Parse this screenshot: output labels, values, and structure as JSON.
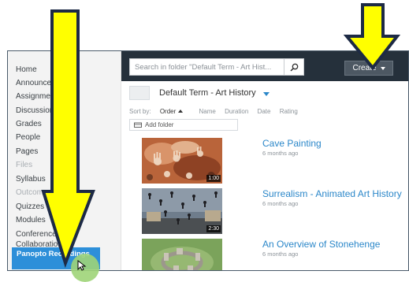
{
  "sidebar": {
    "items": [
      {
        "label": "Home",
        "state": "normal"
      },
      {
        "label": "Announcements",
        "state": "normal"
      },
      {
        "label": "Assignments",
        "state": "normal"
      },
      {
        "label": "Discussions",
        "state": "normal"
      },
      {
        "label": "Grades",
        "state": "normal"
      },
      {
        "label": "People",
        "state": "normal"
      },
      {
        "label": "Pages",
        "state": "normal"
      },
      {
        "label": "Files",
        "state": "disabled"
      },
      {
        "label": "Syllabus",
        "state": "normal"
      },
      {
        "label": "Outcomes",
        "state": "disabled"
      },
      {
        "label": "Quizzes",
        "state": "normal"
      },
      {
        "label": "Modules",
        "state": "normal"
      },
      {
        "label": "Conferences",
        "state": "normal"
      },
      {
        "label": "Collaborations",
        "state": "normal"
      }
    ],
    "active_item": "Panopto Recordings"
  },
  "toolbar": {
    "search_placeholder": "Search in folder \"Default Term - Art Hist...",
    "create_label": "Create"
  },
  "folder": {
    "name": "Default Term - Art History"
  },
  "sort": {
    "prefix": "Sort by:",
    "options": [
      "Order",
      "Name",
      "Duration",
      "Date",
      "Rating"
    ],
    "selected": "Order"
  },
  "add_folder_label": "Add folder",
  "videos": [
    {
      "title": "Cave Painting",
      "meta": "6 months ago",
      "duration": "1:00"
    },
    {
      "title": "Surrealism - Animated Art History",
      "meta": "6 months ago",
      "duration": "2:30"
    },
    {
      "title": "An Overview of Stonehenge",
      "meta": "6 months ago",
      "duration": ""
    }
  ],
  "colors": {
    "topbar": "#25303b",
    "accent": "#2b87c9",
    "active_nav": "#2d8fd9",
    "annotation_arrow": "#ffff00",
    "cursor_highlight": "#9fd478"
  }
}
